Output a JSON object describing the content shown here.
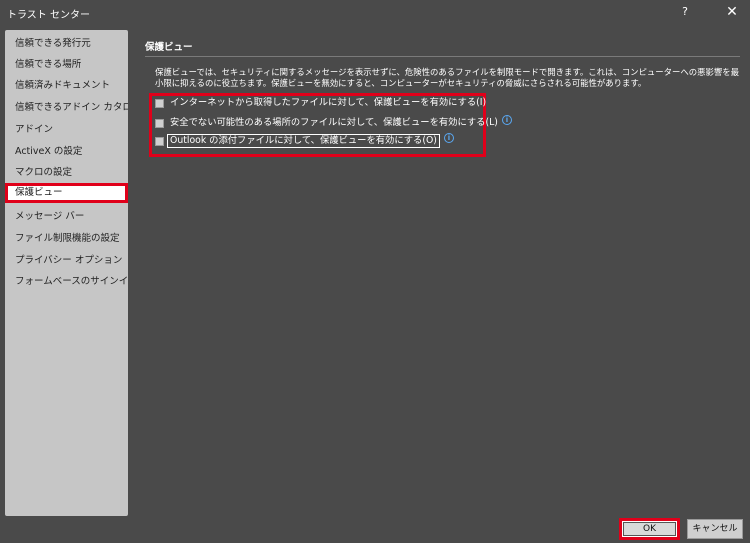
{
  "window": {
    "title": "トラスト センター",
    "help_label": "?",
    "close_label": "✕"
  },
  "sidebar": {
    "items": [
      {
        "label": "信頼できる発行元"
      },
      {
        "label": "信頼できる場所"
      },
      {
        "label": "信頼済みドキュメント"
      },
      {
        "label": "信頼できるアドイン カタログ"
      },
      {
        "label": "アドイン"
      },
      {
        "label": "ActiveX の設定"
      },
      {
        "label": "マクロの設定"
      },
      {
        "label": "保護ビュー"
      },
      {
        "label": "メッセージ バー"
      },
      {
        "label": "ファイル制限機能の設定"
      },
      {
        "label": "プライバシー オプション"
      },
      {
        "label": "フォームベースのサインイン"
      }
    ],
    "selected_index": 7
  },
  "main": {
    "section_title": "保護ビュー",
    "description": "保護ビューでは、セキュリティに関するメッセージを表示せずに、危険性のあるファイルを制限モードで開きます。これは、コンピューターへの悪影響を最小限に抑えるのに役立ちます。保護ビューを無効にすると、コンピューターがセキュリティの脅威にさらされる可能性があります。",
    "options": [
      {
        "label": "インターネットから取得したファイルに対して、保護ビューを有効にする(I)",
        "checked": false,
        "has_info": false
      },
      {
        "label": "安全でない可能性のある場所のファイルに対して、保護ビューを有効にする(L)",
        "checked": false,
        "has_info": true
      },
      {
        "label": "Outlook の添付ファイルに対して、保護ビューを有効にする(O)",
        "checked": false,
        "has_info": true
      }
    ],
    "info_glyph": "i"
  },
  "footer": {
    "ok_label": "OK",
    "cancel_label": "キャンセル"
  },
  "colors": {
    "background": "#4a4a4a",
    "sidebar": "#c6c6c6",
    "highlight": "#e0001a",
    "info": "#5aa8f2"
  }
}
